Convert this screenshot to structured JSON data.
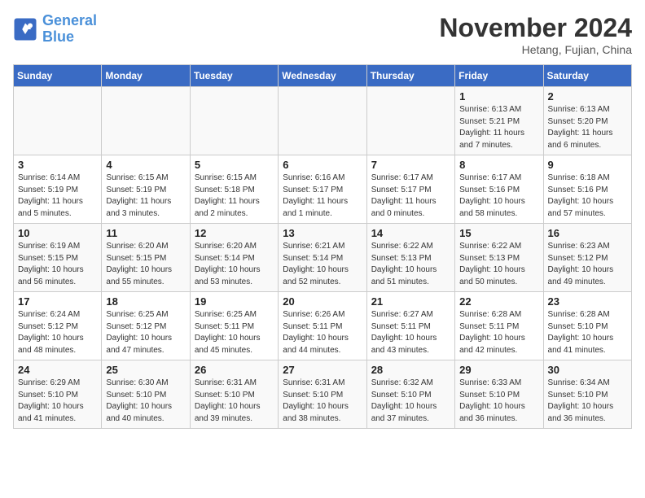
{
  "header": {
    "logo_line1": "General",
    "logo_line2": "Blue",
    "month": "November 2024",
    "location": "Hetang, Fujian, China"
  },
  "weekdays": [
    "Sunday",
    "Monday",
    "Tuesday",
    "Wednesday",
    "Thursday",
    "Friday",
    "Saturday"
  ],
  "weeks": [
    [
      {
        "day": "",
        "info": ""
      },
      {
        "day": "",
        "info": ""
      },
      {
        "day": "",
        "info": ""
      },
      {
        "day": "",
        "info": ""
      },
      {
        "day": "",
        "info": ""
      },
      {
        "day": "1",
        "info": "Sunrise: 6:13 AM\nSunset: 5:21 PM\nDaylight: 11 hours and 7 minutes."
      },
      {
        "day": "2",
        "info": "Sunrise: 6:13 AM\nSunset: 5:20 PM\nDaylight: 11 hours and 6 minutes."
      }
    ],
    [
      {
        "day": "3",
        "info": "Sunrise: 6:14 AM\nSunset: 5:19 PM\nDaylight: 11 hours and 5 minutes."
      },
      {
        "day": "4",
        "info": "Sunrise: 6:15 AM\nSunset: 5:19 PM\nDaylight: 11 hours and 3 minutes."
      },
      {
        "day": "5",
        "info": "Sunrise: 6:15 AM\nSunset: 5:18 PM\nDaylight: 11 hours and 2 minutes."
      },
      {
        "day": "6",
        "info": "Sunrise: 6:16 AM\nSunset: 5:17 PM\nDaylight: 11 hours and 1 minute."
      },
      {
        "day": "7",
        "info": "Sunrise: 6:17 AM\nSunset: 5:17 PM\nDaylight: 11 hours and 0 minutes."
      },
      {
        "day": "8",
        "info": "Sunrise: 6:17 AM\nSunset: 5:16 PM\nDaylight: 10 hours and 58 minutes."
      },
      {
        "day": "9",
        "info": "Sunrise: 6:18 AM\nSunset: 5:16 PM\nDaylight: 10 hours and 57 minutes."
      }
    ],
    [
      {
        "day": "10",
        "info": "Sunrise: 6:19 AM\nSunset: 5:15 PM\nDaylight: 10 hours and 56 minutes."
      },
      {
        "day": "11",
        "info": "Sunrise: 6:20 AM\nSunset: 5:15 PM\nDaylight: 10 hours and 55 minutes."
      },
      {
        "day": "12",
        "info": "Sunrise: 6:20 AM\nSunset: 5:14 PM\nDaylight: 10 hours and 53 minutes."
      },
      {
        "day": "13",
        "info": "Sunrise: 6:21 AM\nSunset: 5:14 PM\nDaylight: 10 hours and 52 minutes."
      },
      {
        "day": "14",
        "info": "Sunrise: 6:22 AM\nSunset: 5:13 PM\nDaylight: 10 hours and 51 minutes."
      },
      {
        "day": "15",
        "info": "Sunrise: 6:22 AM\nSunset: 5:13 PM\nDaylight: 10 hours and 50 minutes."
      },
      {
        "day": "16",
        "info": "Sunrise: 6:23 AM\nSunset: 5:12 PM\nDaylight: 10 hours and 49 minutes."
      }
    ],
    [
      {
        "day": "17",
        "info": "Sunrise: 6:24 AM\nSunset: 5:12 PM\nDaylight: 10 hours and 48 minutes."
      },
      {
        "day": "18",
        "info": "Sunrise: 6:25 AM\nSunset: 5:12 PM\nDaylight: 10 hours and 47 minutes."
      },
      {
        "day": "19",
        "info": "Sunrise: 6:25 AM\nSunset: 5:11 PM\nDaylight: 10 hours and 45 minutes."
      },
      {
        "day": "20",
        "info": "Sunrise: 6:26 AM\nSunset: 5:11 PM\nDaylight: 10 hours and 44 minutes."
      },
      {
        "day": "21",
        "info": "Sunrise: 6:27 AM\nSunset: 5:11 PM\nDaylight: 10 hours and 43 minutes."
      },
      {
        "day": "22",
        "info": "Sunrise: 6:28 AM\nSunset: 5:11 PM\nDaylight: 10 hours and 42 minutes."
      },
      {
        "day": "23",
        "info": "Sunrise: 6:28 AM\nSunset: 5:10 PM\nDaylight: 10 hours and 41 minutes."
      }
    ],
    [
      {
        "day": "24",
        "info": "Sunrise: 6:29 AM\nSunset: 5:10 PM\nDaylight: 10 hours and 41 minutes."
      },
      {
        "day": "25",
        "info": "Sunrise: 6:30 AM\nSunset: 5:10 PM\nDaylight: 10 hours and 40 minutes."
      },
      {
        "day": "26",
        "info": "Sunrise: 6:31 AM\nSunset: 5:10 PM\nDaylight: 10 hours and 39 minutes."
      },
      {
        "day": "27",
        "info": "Sunrise: 6:31 AM\nSunset: 5:10 PM\nDaylight: 10 hours and 38 minutes."
      },
      {
        "day": "28",
        "info": "Sunrise: 6:32 AM\nSunset: 5:10 PM\nDaylight: 10 hours and 37 minutes."
      },
      {
        "day": "29",
        "info": "Sunrise: 6:33 AM\nSunset: 5:10 PM\nDaylight: 10 hours and 36 minutes."
      },
      {
        "day": "30",
        "info": "Sunrise: 6:34 AM\nSunset: 5:10 PM\nDaylight: 10 hours and 36 minutes."
      }
    ]
  ]
}
